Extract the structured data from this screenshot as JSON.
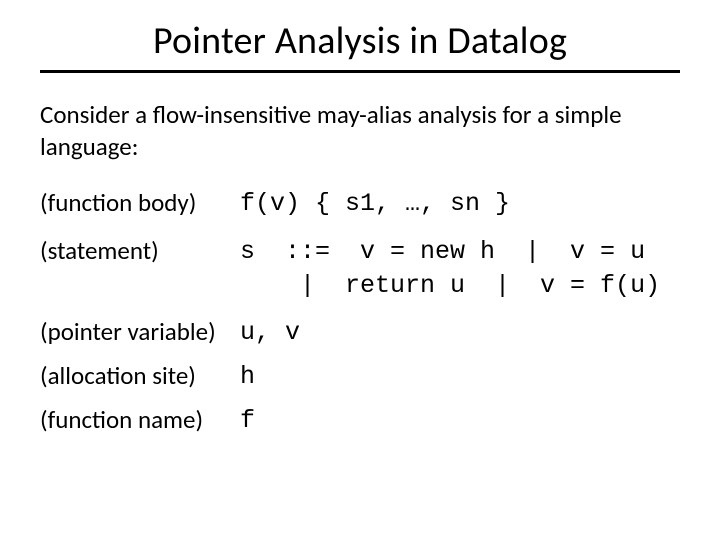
{
  "title": "Pointer Analysis in Datalog",
  "intro": "Consider a flow-insensitive may-alias analysis for a simple language:",
  "grammar": {
    "function_body": {
      "label": "(function body)",
      "rhs": "f(v) { s1, …, sn }"
    },
    "statement": {
      "label": "(statement)",
      "rhs": "s  ::=  v = new h  |  v = u\n    |  return u  |  v = f(u)"
    },
    "pointer_variable": {
      "label": "(pointer variable)",
      "rhs": "u, v"
    },
    "allocation_site": {
      "label": "(allocation site)",
      "rhs": "h"
    },
    "function_name": {
      "label": "(function name)",
      "rhs": "f"
    }
  }
}
